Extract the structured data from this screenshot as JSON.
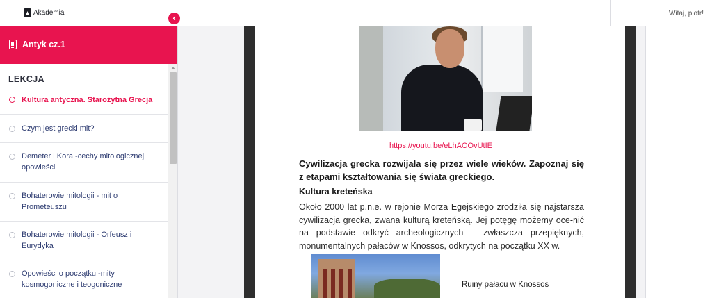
{
  "topbar": {
    "logo_text": "Akademia",
    "greeting": "Witaj, piotr!"
  },
  "sidebar": {
    "course_title": "Antyk cz.1",
    "section_label": "LEKCJA",
    "lessons": [
      {
        "label": "Kultura antyczna. Starożytna Grecja",
        "active": true
      },
      {
        "label": "Czym jest grecki mit?",
        "active": false
      },
      {
        "label": "Demeter i Kora -cechy mitologicznej opowieści",
        "active": false
      },
      {
        "label": "Bohaterowie mitologii - mit o Prometeuszu",
        "active": false
      },
      {
        "label": "Bohaterowie mitologii - Orfeusz i Eurydyka",
        "active": false
      },
      {
        "label": "Opowieści o początku -mity kosmogoniczne i teogoniczne",
        "active": false
      }
    ]
  },
  "document": {
    "video_link": "https://youtu.be/eLhAOOvUtIE",
    "intro": "Cywilizacja grecka rozwijała się przez wiele wieków. Zapoznaj się z etapami kształtowania się świata greckiego.",
    "subheading": "Kultura kreteńska",
    "paragraph": "Około 2000 lat p.n.e. w rejonie Morza Egejskiego zrodziła się najstarsza cywilizacja grecka, zwana kulturą kreteńską. Jej potęgę możemy oce-nić na podstawie odkryć archeologicznych – zwłaszcza przepięknych, monumentalnych pałaców w Knossos, odkrytych na początku XX w.",
    "image_caption": "Ruiny pałacu w Knossos"
  },
  "colors": {
    "accent": "#e8144f",
    "link": "#2f3d72"
  }
}
